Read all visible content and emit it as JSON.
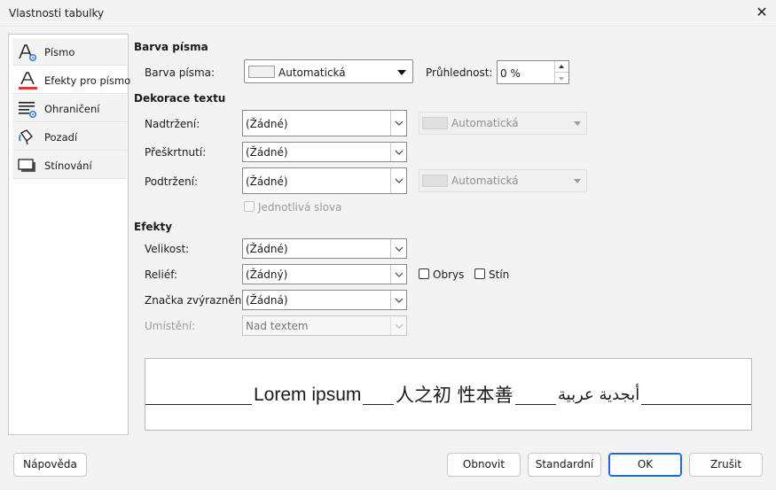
{
  "window": {
    "title": "Vlastnosti tabulky"
  },
  "nav": {
    "items": [
      {
        "label": "Písmo",
        "icon": "font-settings-icon"
      },
      {
        "label": "Efekty pro písmo",
        "icon": "font-color-icon"
      },
      {
        "label": "Ohraničení",
        "icon": "borders-icon"
      },
      {
        "label": "Pozadí",
        "icon": "background-fill-icon"
      },
      {
        "label": "Stínování",
        "icon": "shadow-icon"
      }
    ],
    "selected": "Efekty pro písmo"
  },
  "font_color": {
    "section": "Barva písma",
    "label": "Barva písma:",
    "value": "Automatická",
    "transparency_label": "Průhlednost:",
    "transparency_value": "0 %"
  },
  "decoration": {
    "section": "Dekorace textu",
    "overline_label": "Nadtržení:",
    "overline_value": "(Žádné)",
    "overline_color": "Automatická",
    "strike_label": "Přeškrtnutí:",
    "strike_value": "(Žádné)",
    "underline_label": "Podtržení:",
    "underline_value": "(Žádné)",
    "underline_color": "Automatická",
    "words_only_label": "Jednotlivá slova"
  },
  "effects": {
    "section": "Efekty",
    "case_label": "Velikost:",
    "case_value": "(Žádné)",
    "relief_label": "Reliéf:",
    "relief_value": "(Žádný)",
    "outline_label": "Obrys",
    "shadow_label": "Stín",
    "emphasis_label": "Značka zvýraznění:",
    "emphasis_value": "(Žádná)",
    "position_label": "Umístění:",
    "position_value": "Nad textem"
  },
  "preview": {
    "latin": "Lorem ipsum",
    "cjk": "人之初 性本善",
    "ctl": "أبجدية عربية"
  },
  "buttons": {
    "help": "Nápověda",
    "reset": "Obnovit",
    "standard": "Standardní",
    "ok": "OK",
    "cancel": "Zrušit"
  }
}
